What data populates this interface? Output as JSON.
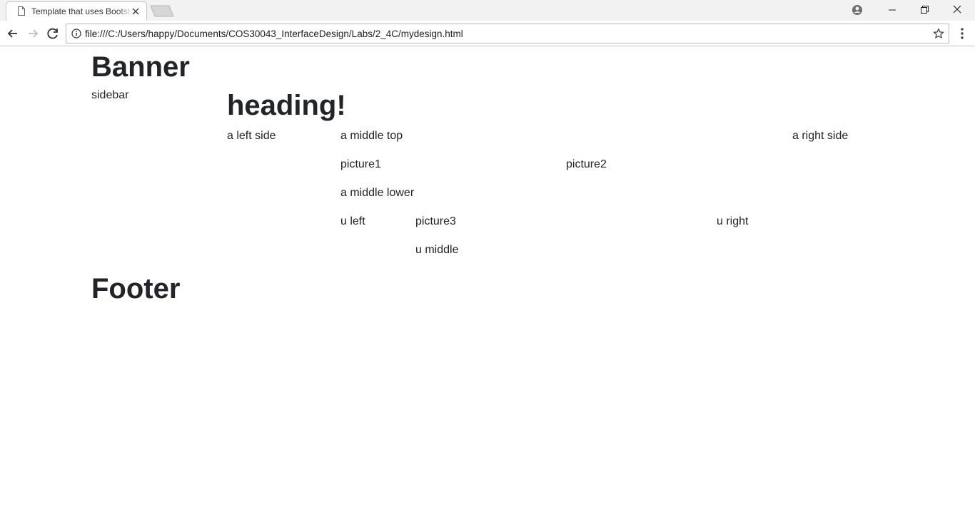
{
  "browser": {
    "tab_title": "Template that uses Bootstrap",
    "url": "file:///C:/Users/happy/Documents/COS30043_InterfaceDesign/Labs/2_4C/mydesign.html"
  },
  "page": {
    "banner": "Banner",
    "sidebar": "sidebar",
    "heading": "heading!",
    "left_side": "a left side",
    "middle_top": "a middle top",
    "right_side": "a right side",
    "picture1": "picture1",
    "picture2": "picture2",
    "middle_lower": "a middle lower",
    "u_left": "u left",
    "picture3": "picture3",
    "u_right": "u right",
    "u_middle": "u middle",
    "footer": "Footer"
  },
  "icons": {
    "tab": "page-icon",
    "close": "close-icon",
    "back": "back-arrow-icon",
    "forward": "forward-arrow-icon",
    "reload": "reload-icon",
    "info": "info-icon",
    "bookmark": "star-icon",
    "menu": "kebab-menu-icon",
    "profile": "profile-icon",
    "minimize": "minimize-icon",
    "restore": "restore-icon",
    "window_close": "window-close-icon"
  }
}
